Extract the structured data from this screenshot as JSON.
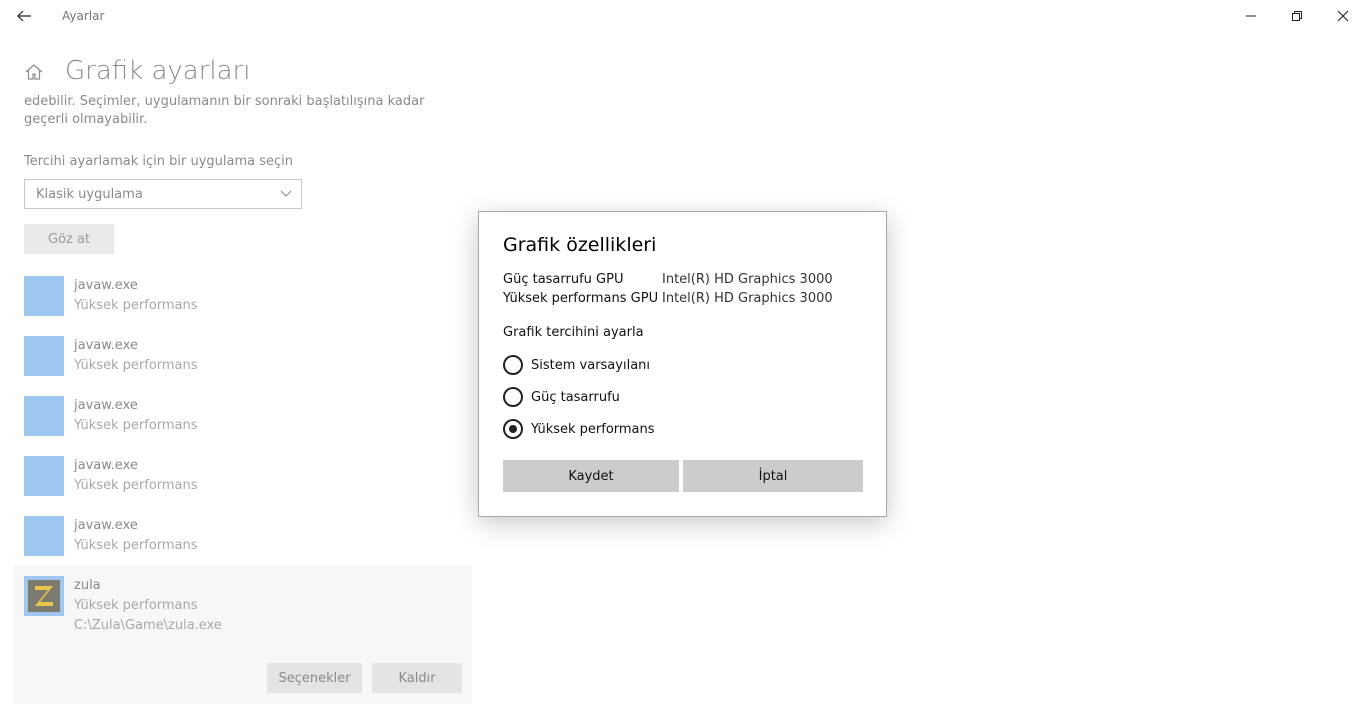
{
  "window": {
    "title": "Ayarlar",
    "back_icon": "arrow-left-icon",
    "minimize_icon": "minimize-icon",
    "maximize_icon": "restore-icon",
    "close_icon": "close-icon"
  },
  "page": {
    "title": "Grafik ayarları",
    "description": "edebilir. Seçimler, uygulamanın bir sonraki başlatılışına kadar geçerli olmayabilir.",
    "pick_label": "Tercihi ayarlamak için bir uygulama seçin",
    "dropdown_value": "Klasik uygulama",
    "browse_label": "Göz at",
    "apps": [
      {
        "name": "javaw.exe",
        "preference": "Yüksek performans"
      },
      {
        "name": "javaw.exe",
        "preference": "Yüksek performans"
      },
      {
        "name": "javaw.exe",
        "preference": "Yüksek performans"
      },
      {
        "name": "javaw.exe",
        "preference": "Yüksek performans"
      },
      {
        "name": "javaw.exe",
        "preference": "Yüksek performans"
      }
    ],
    "selected_app": {
      "name": "zula",
      "preference": "Yüksek performans",
      "path": "C:\\Zula\\Game\\zula.exe",
      "options_label": "Seçenekler",
      "remove_label": "Kaldır"
    }
  },
  "dialog": {
    "title": "Grafik özellikleri",
    "power_saving_gpu_label": "Güç tasarrufu GPU",
    "power_saving_gpu_value": "Intel(R) HD Graphics 3000",
    "high_perf_gpu_label": "Yüksek performans GPU",
    "high_perf_gpu_value": "Intel(R) HD Graphics 3000",
    "pref_label": "Grafik tercihini ayarla",
    "options": [
      {
        "label": "Sistem varsayılanı",
        "selected": false
      },
      {
        "label": "Güç tasarrufu",
        "selected": false
      },
      {
        "label": "Yüksek performans",
        "selected": true
      }
    ],
    "save_label": "Kaydet",
    "cancel_label": "İptal"
  }
}
